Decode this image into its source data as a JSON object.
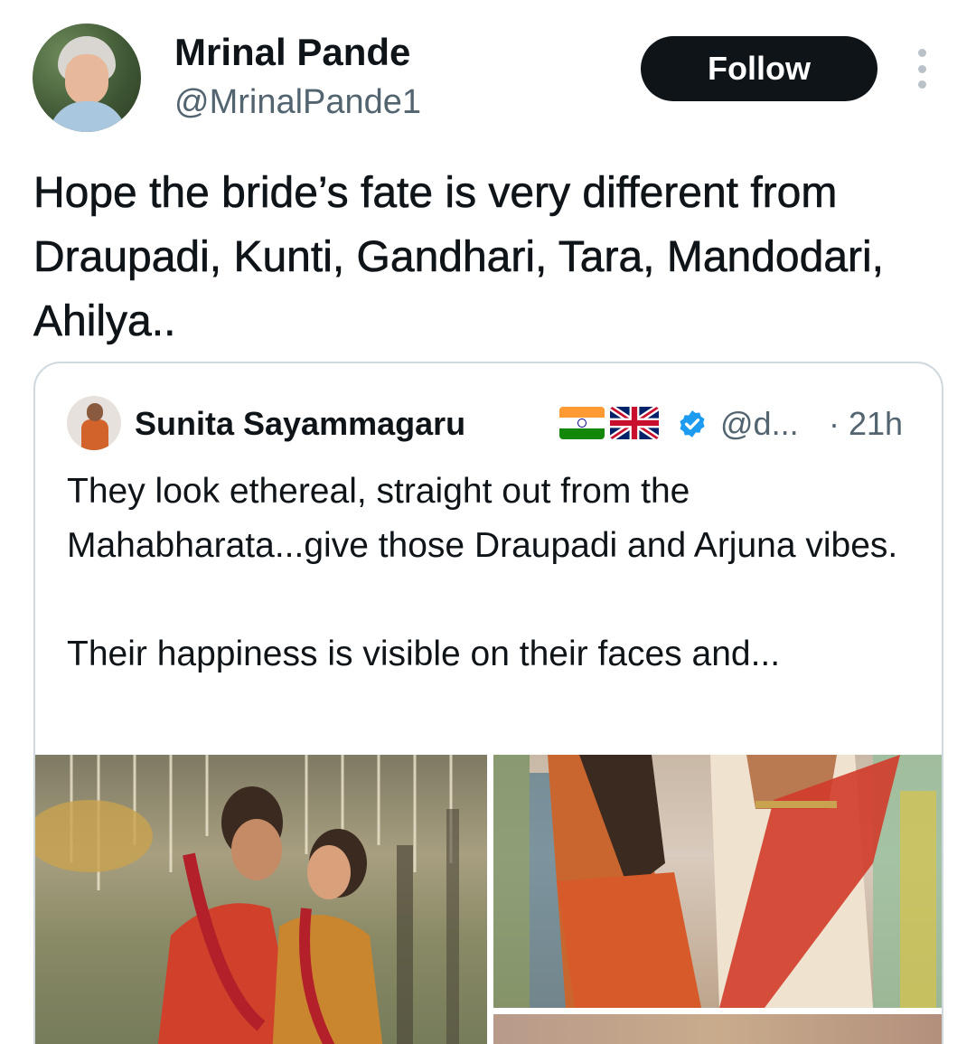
{
  "tweet": {
    "author_name": "Mrinal Pande",
    "author_handle": "@MrinalPande1",
    "follow_label": "Follow",
    "more_icon": "more-vertical-icon",
    "text": "Hope the bride’s fate is very different from Draupadi, Kunti, Gandhari, Tara, Mandodari, Ahilya.."
  },
  "quote": {
    "author_name": "Sunita Sayammagaru",
    "flags": [
      "india-flag-icon",
      "uk-flag-icon"
    ],
    "verified_icon": "verified-badge-icon",
    "author_handle": "@d...",
    "time": "· 21h",
    "text": "They look ethereal, straight out from the Mahabharata...give those Draupadi and Arjuna vibes.\n\nTheir happiness is visible on their faces and..."
  },
  "colors": {
    "follow_bg": "#0f1419",
    "secondary_text": "#536471",
    "verified": "#1d9bf0",
    "border": "#cfd9de"
  }
}
